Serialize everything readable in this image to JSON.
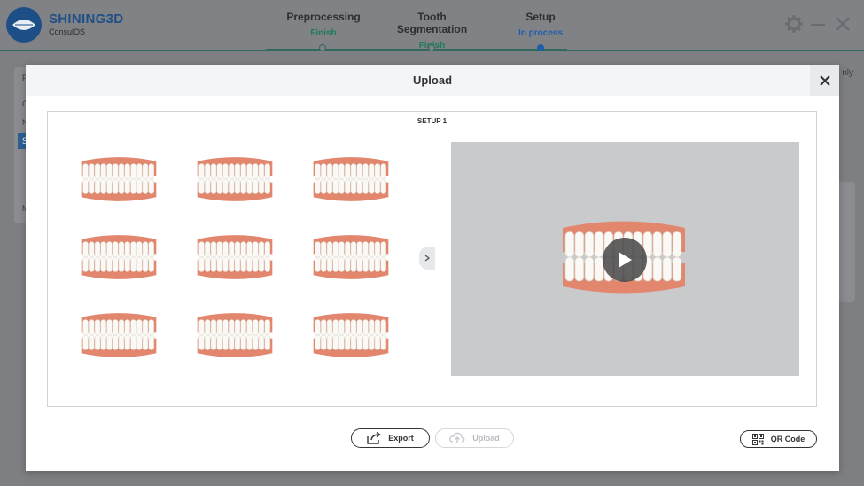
{
  "app": {
    "brand_name": "SHINING3D",
    "brand_sub": "ConsulOS"
  },
  "steps": [
    {
      "title": "Preprocessing",
      "status": "Finish",
      "status_color": "#1f7a5c"
    },
    {
      "title": "Tooth Segmentation",
      "status": "Finish",
      "status_color": "#1f7a5c"
    },
    {
      "title": "Setup",
      "status": "In process",
      "status_color": "#1f5ea8"
    }
  ],
  "window_controls": {
    "settings_icon": "gear-icon",
    "minimize_icon": "minimize-icon",
    "close_icon": "close-icon"
  },
  "background": {
    "left_panel_letters": [
      "P",
      "C",
      "N",
      "S",
      "M"
    ],
    "right_text": "nly"
  },
  "dialog": {
    "title": "Upload",
    "close_icon": "close-icon",
    "setup_label": "SETUP 1",
    "thumbnail_count": 9,
    "play_icon": "play-icon",
    "collapse_icon": "chevron-right-icon"
  },
  "buttons": {
    "export_label": "Export",
    "upload_label": "Upload",
    "qr_label": "QR Code"
  },
  "colors": {
    "accent_green": "#1f7a5c",
    "accent_blue": "#1f5ea8",
    "brand_blue": "#1e4f86",
    "gum": "#e2866d",
    "teeth": "#fbf9f5"
  }
}
